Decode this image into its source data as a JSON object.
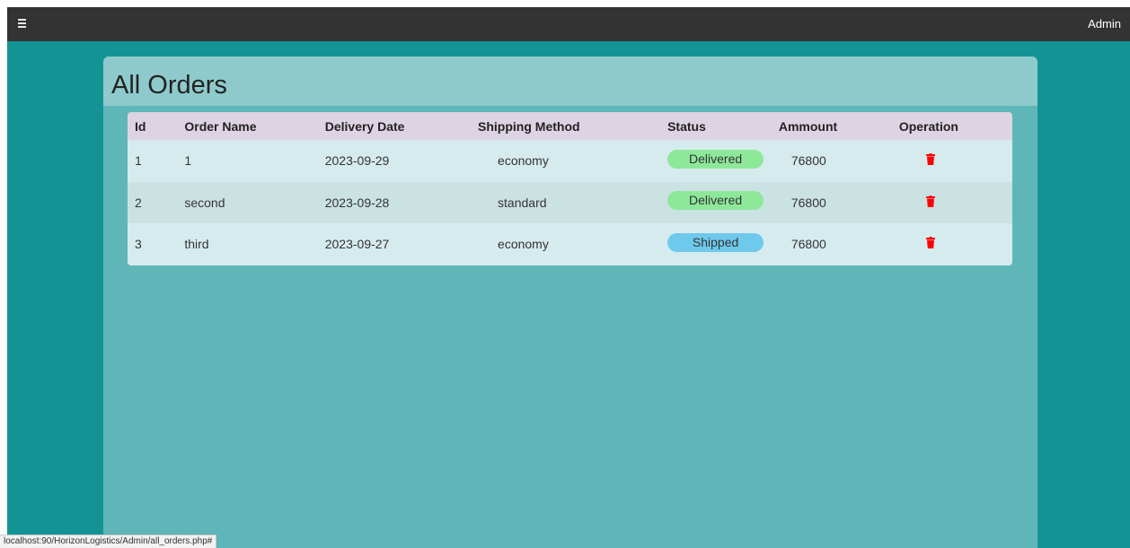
{
  "topbar": {
    "menu_icon": "hamburger-icon",
    "user_label": "Admin"
  },
  "page": {
    "title": "All Orders"
  },
  "table": {
    "headers": [
      "Id",
      "Order Name",
      "Delivery Date",
      "Shipping Method",
      "Status",
      "Ammount",
      "Operation"
    ],
    "rows": [
      {
        "id": "1",
        "name": "1",
        "date": "2023-09-29",
        "shipping": "economy",
        "status": "Delivered",
        "amount": "76800"
      },
      {
        "id": "2",
        "name": "second",
        "date": "2023-09-28",
        "shipping": "standard",
        "status": "Delivered",
        "amount": "76800"
      },
      {
        "id": "3",
        "name": "third",
        "date": "2023-09-27",
        "shipping": "economy",
        "status": "Shipped",
        "amount": "76800"
      }
    ],
    "operation_icon": "trash-icon"
  },
  "colors": {
    "background": "#139393",
    "topbar": "#333333",
    "panel": "#5eb6b8",
    "panel_header": "#8ecacb",
    "table_header": "#ddd3e3",
    "delivered": "#8ee89a",
    "shipped": "#6ec9ec",
    "delete": "#ff0000"
  },
  "status_bar": {
    "url": "localhost:90/HorizonLogistics/Admin/all_orders.php#"
  }
}
